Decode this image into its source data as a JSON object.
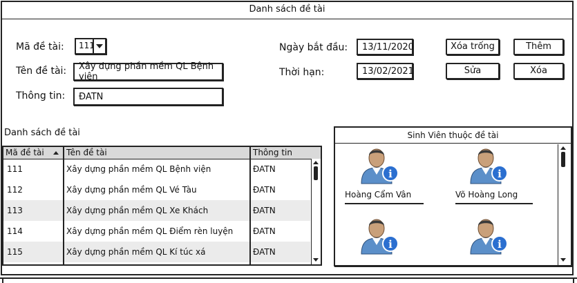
{
  "window": {
    "title": "Danh sách đề tài"
  },
  "form": {
    "ma_label": "Mã đề tài:",
    "ma_value": "111",
    "ten_label": "Tên đề tài:",
    "ten_value": "Xây dựng phần mềm QL Bệnh viện",
    "thongtin_label": "Thông tin:",
    "thongtin_value": "ĐATN",
    "ngay_label": "Ngày bắt đầu:",
    "ngay_value": "13/11/2020",
    "thoihan_label": "Thời hạn:",
    "thoihan_value": "13/02/2021"
  },
  "buttons": {
    "clear": "Xóa trống",
    "add": "Thêm",
    "edit": "Sửa",
    "delete": "Xóa"
  },
  "list": {
    "title": "Danh sách đề tài",
    "columns": [
      "Mã đề tài",
      "Tên đề tài",
      "Thông tin"
    ],
    "rows": [
      {
        "ma": "111",
        "ten": "Xây dựng phần mềm QL Bệnh viện",
        "info": "ĐATN"
      },
      {
        "ma": "112",
        "ten": "Xây dựng phần mềm QL Vé Tàu",
        "info": "ĐATN"
      },
      {
        "ma": "113",
        "ten": "Xây dựng phần mềm QL Xe Khách",
        "info": "ĐATN"
      },
      {
        "ma": "114",
        "ten": "Xây dựng phần mềm QL Điểm rèn luyện",
        "info": "ĐATN"
      },
      {
        "ma": "115",
        "ten": "Xây dựng phần mềm QL Kí túc xá",
        "info": "ĐATN"
      }
    ]
  },
  "students": {
    "title": "Sinh Viên thuộc đề tài",
    "items": [
      {
        "name": "Hoàng Cẩm Vân",
        "icon": "user-info-icon"
      },
      {
        "name": "Võ Hoàng Long",
        "icon": "user-info-icon"
      },
      {
        "name": "",
        "icon": "user-info-icon"
      },
      {
        "name": "",
        "icon": "user-info-icon"
      }
    ]
  },
  "colors": {
    "border": "#222222",
    "header_bg": "#d9d9d9",
    "alt_row": "#ebebeb",
    "avatar_skin": "#c9a07a",
    "avatar_shirt": "#5b8fc9",
    "info_badge": "#2b6fd0"
  }
}
